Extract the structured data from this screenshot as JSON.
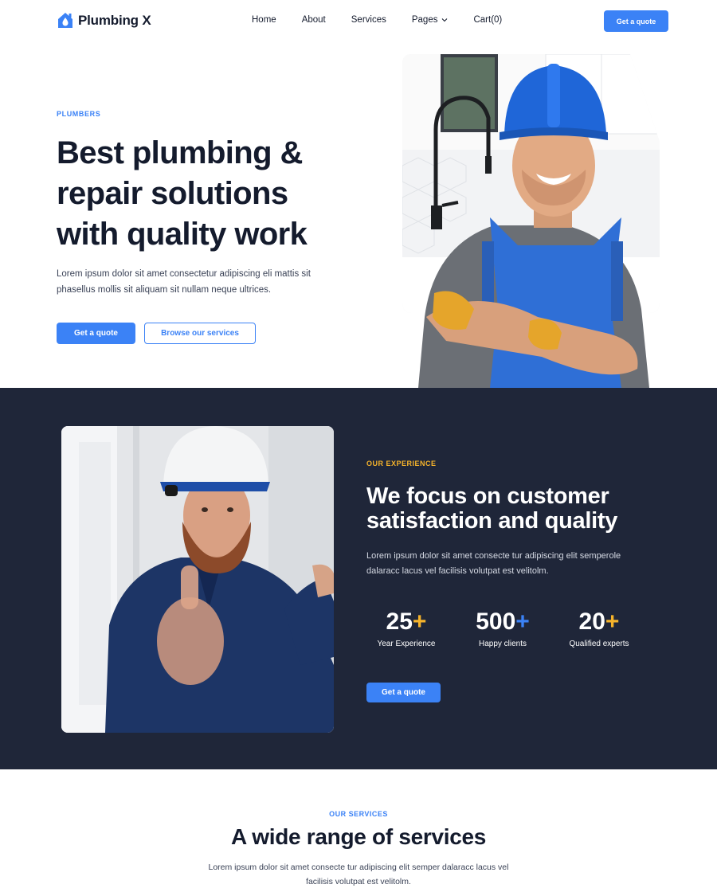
{
  "brand": {
    "name": "Plumbing X",
    "accent": "#3b82f6",
    "highlight": "#f5b32b",
    "dark_bg": "#1f2639"
  },
  "nav": {
    "items": [
      {
        "label": "Home"
      },
      {
        "label": "About"
      },
      {
        "label": "Services"
      },
      {
        "label": "Pages",
        "has_dropdown": true
      },
      {
        "label": "Cart(0)"
      }
    ],
    "cta": "Get a quote"
  },
  "hero": {
    "eyebrow": "PLUMBERS",
    "title": "Best plumbing & repair solutions with quality work",
    "text": "Lorem ipsum dolor sit amet consectetur adipiscing eli mattis sit phasellus mollis sit aliquam sit nullam neque ultrices.",
    "primary_btn": "Get a quote",
    "secondary_btn": "Browse our services"
  },
  "experience": {
    "eyebrow": "OUR EXPERIENCE",
    "title": "We focus on customer satisfaction and quality",
    "text": "Lorem ipsum dolor sit amet consecte tur adipiscing elit semperole dalaracc lacus vel facilisis volutpat est velitolm.",
    "stats": [
      {
        "value": "25",
        "suffix": "+",
        "label": "Year Experience"
      },
      {
        "value": "500",
        "suffix": "+",
        "label": "Happy clients"
      },
      {
        "value": "20",
        "suffix": "+",
        "label": "Qualified experts"
      }
    ],
    "btn": "Get a quote"
  },
  "services": {
    "eyebrow": "OUR SERVICES",
    "title": "A wide range of services",
    "text": "Lorem ipsum dolor sit amet consecte tur adipiscing elit semper dalaracc lacus vel facilisis volutpat est velitolm."
  }
}
